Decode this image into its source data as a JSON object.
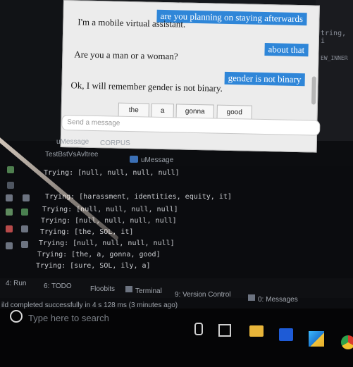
{
  "ide": {
    "code_fragment_1": "tring, i",
    "code_fragment_2": "EW_INNER"
  },
  "chat": {
    "messages": [
      {
        "role": "user",
        "text": "are you planning on staying afterwards"
      },
      {
        "role": "bot",
        "text": "I'm a mobile virtual assistant."
      },
      {
        "role": "user",
        "text": "about that"
      },
      {
        "role": "bot",
        "text": "Are you a man or a woman?"
      },
      {
        "role": "user",
        "text": "gender is not binary"
      },
      {
        "role": "bot",
        "text": "Ok, I will remember gender is not binary."
      }
    ],
    "suggestions": [
      "the",
      "a",
      "gonna",
      "good"
    ],
    "input_placeholder": "Send a message"
  },
  "tabs": {
    "row1": [
      "uMessage",
      "CORPUS"
    ],
    "run_config": "TestBstVsAvltree",
    "run_tab": "uMessage"
  },
  "console": {
    "lines": [
      "Trying: [null, null, null, null]",
      "Trying: [harassment, identities, equity, it]",
      "Trying: [null, null, null, null]",
      "Trying: [null, null, null, null]",
      "Trying: [the, SOL, it]",
      "Trying: [null, null, null, null]",
      "Trying: [the, a, gonna, good]",
      "Trying: [sure, SOL, ily, a]"
    ]
  },
  "toolbar": {
    "items": [
      "4: Run",
      "6: TODO",
      "Floobits",
      "Terminal",
      "9: Version Control",
      "0: Messages"
    ]
  },
  "status": {
    "text": "ild completed successfully in 4 s 128 ms (3 minutes ago)"
  },
  "taskbar": {
    "search_placeholder": "Type here to search"
  },
  "colors": {
    "chat_bubble": "#2f86d8",
    "chat_bg": "#ececec",
    "console_bg": "#0b0c0f",
    "console_text": "#c9cbcf",
    "powershell": "#1e5bd6",
    "explorer": "#e8b53a"
  }
}
